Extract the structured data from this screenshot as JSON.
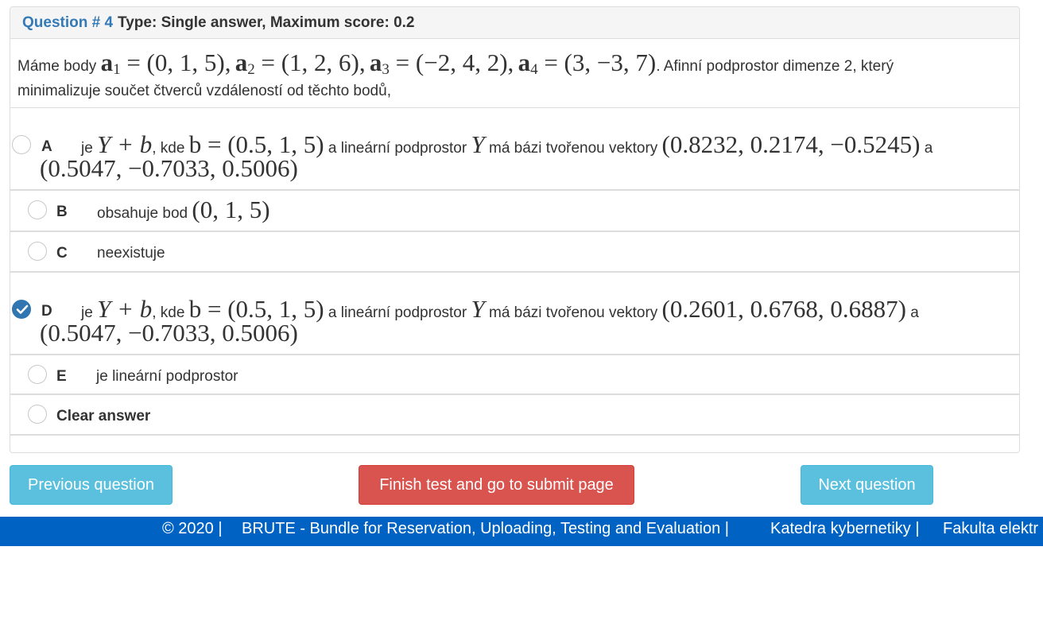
{
  "question": {
    "number_label": "Question # 4",
    "type_label": "Type: Single answer, Maximum score: 0.2",
    "text_prefix": "Máme body",
    "points": [
      {
        "name": "a",
        "index": "1",
        "value": "(0, 1, 5)"
      },
      {
        "name": "a",
        "index": "2",
        "value": "(1, 2, 6)"
      },
      {
        "name": "a",
        "index": "3",
        "value": "(−2, 4, 2)"
      },
      {
        "name": "a",
        "index": "4",
        "value": "(3, −3, 7)"
      }
    ],
    "text_suffix": ". Afinní podprostor dimenze 2, který",
    "text_line2": "minimalizuje součet čtverců vzdáleností od těchto bodů,"
  },
  "answers": [
    {
      "letter": "A",
      "checked": false,
      "t1": "je",
      "m1": "Y + b",
      "t2": ", kde",
      "m2": "b = (0.5, 1, 5)",
      "t3": "a lineární podprostor",
      "m3": "Y",
      "t4": "má bázi tvořenou vektory",
      "m4": "(0.8232, 0.2174, −0.5245)",
      "t5": "a",
      "m5": "(0.5047, −0.7033, 0.5006)"
    },
    {
      "letter": "B",
      "checked": false,
      "t1": "obsahuje bod",
      "m1": "(0, 1, 5)"
    },
    {
      "letter": "C",
      "checked": false,
      "t1": "neexistuje"
    },
    {
      "letter": "D",
      "checked": true,
      "t1": "je",
      "m1": "Y + b",
      "t2": ", kde",
      "m2": "b = (0.5, 1, 5)",
      "t3": "a lineární podprostor",
      "m3": "Y",
      "t4": "má bázi tvořenou vektory",
      "m4": "(0.2601, 0.6768, 0.6887)",
      "t5": "a",
      "m5": "(0.5047, −0.7033, 0.5006)"
    },
    {
      "letter": "E",
      "checked": false,
      "t1": "je lineární podprostor"
    },
    {
      "letter": "",
      "checked": false,
      "t1": "Clear answer"
    }
  ],
  "buttons": {
    "previous": "Previous question",
    "finish": "Finish test and go to submit page",
    "next": "Next question"
  },
  "footer": {
    "copyright": "© 2020 |",
    "brute": "BRUTE - Bundle for Reservation, Uploading, Testing and Evaluation |",
    "katedra": "Katedra kybernetiky |",
    "fakulta": "Fakulta elektr"
  },
  "colors": {
    "link_blue": "#337ab7",
    "info": "#5bc0de",
    "danger": "#d9534f",
    "footer_bg": "#0063c3",
    "radio_checked": "#3276b1"
  }
}
